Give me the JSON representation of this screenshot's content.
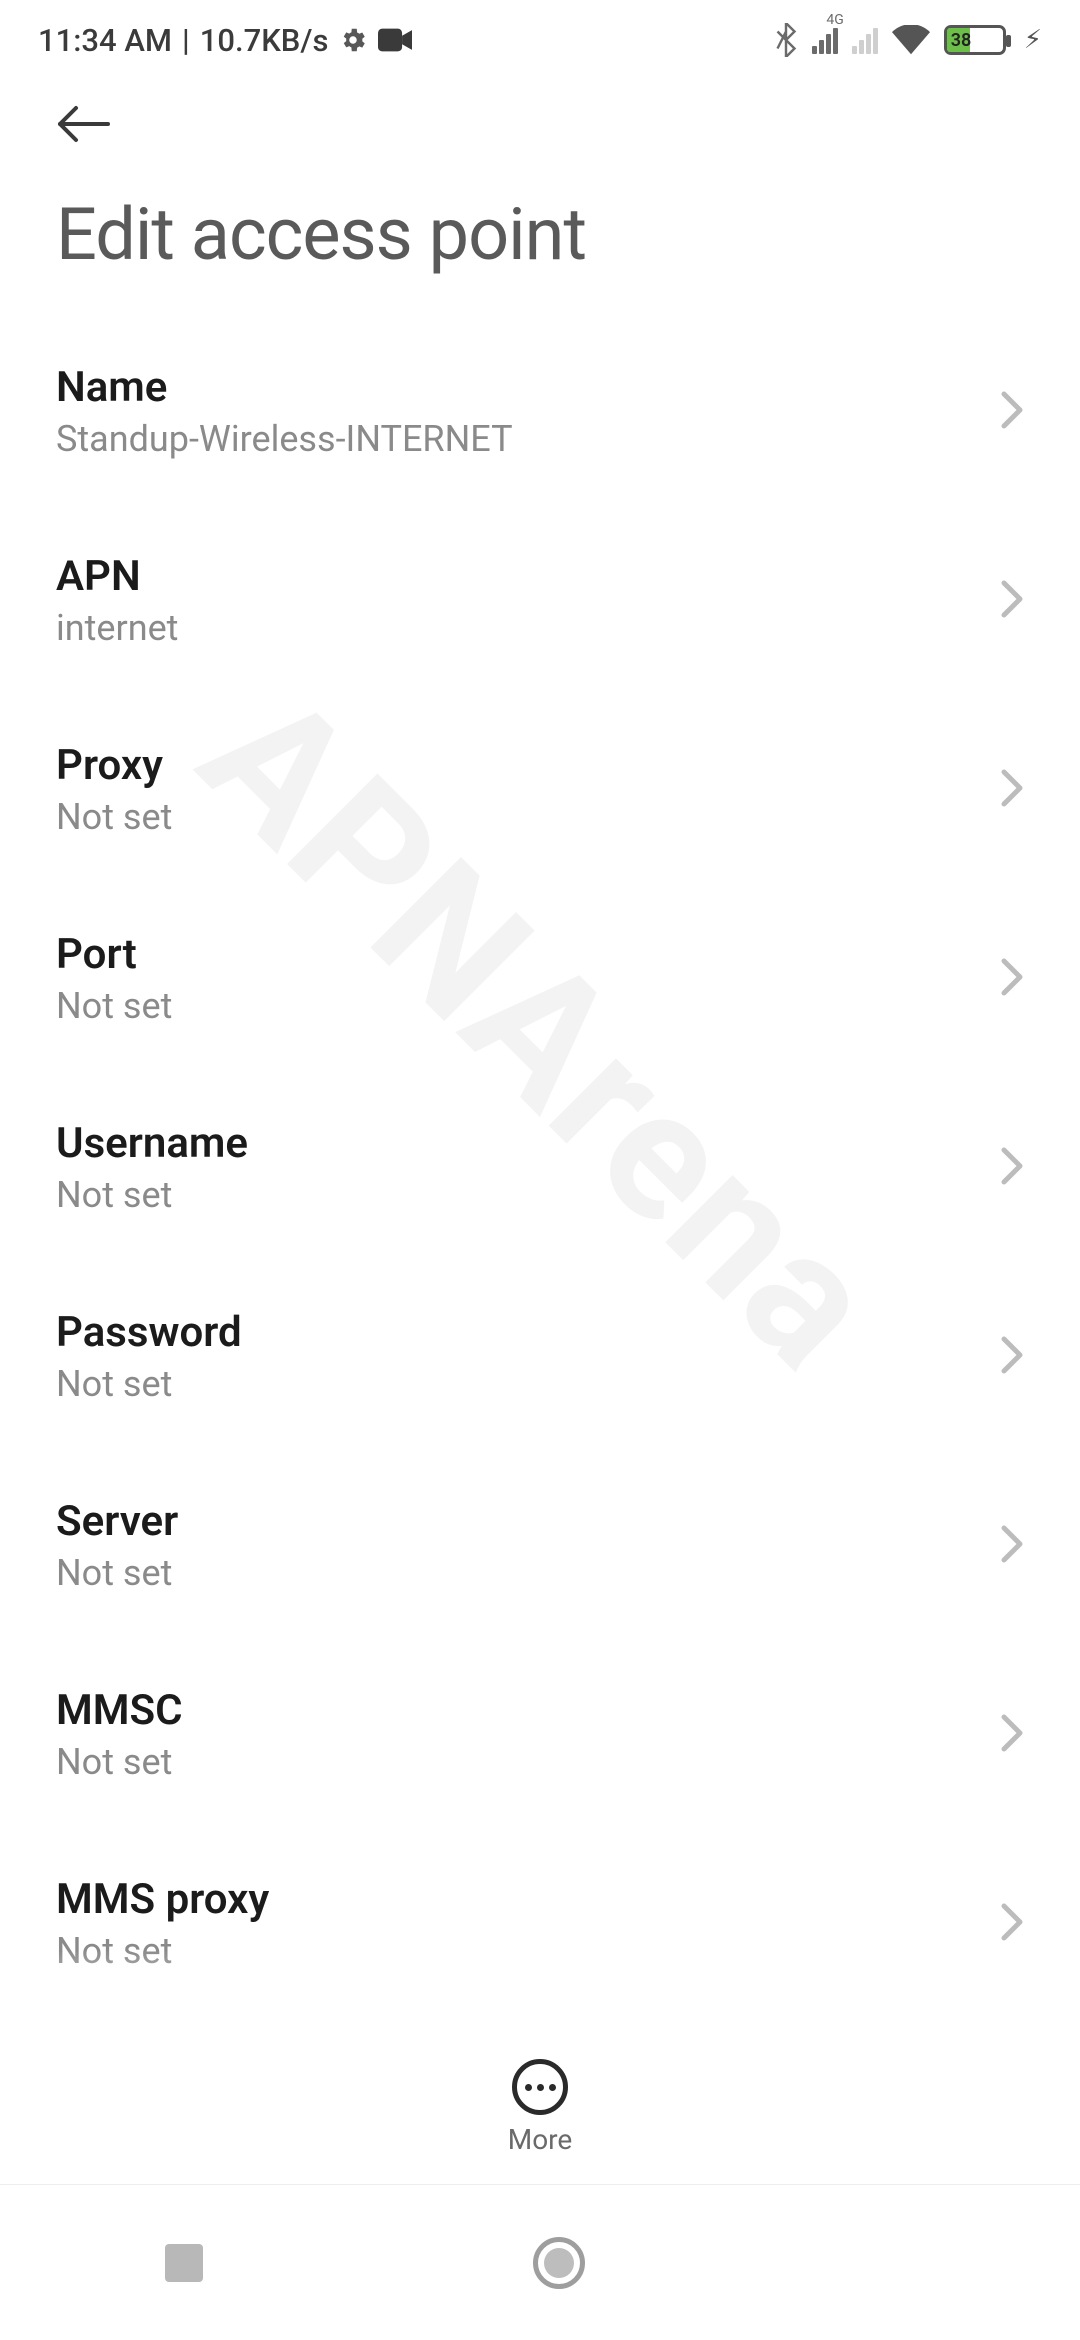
{
  "status": {
    "time": "11:34 AM",
    "separator": "|",
    "speed": "10.7KB/s",
    "battery_percent": "38",
    "signal1_label": "4G"
  },
  "header": {
    "title": "Edit access point"
  },
  "settings": [
    {
      "label": "Name",
      "value": "Standup-Wireless-INTERNET"
    },
    {
      "label": "APN",
      "value": "internet"
    },
    {
      "label": "Proxy",
      "value": "Not set"
    },
    {
      "label": "Port",
      "value": "Not set"
    },
    {
      "label": "Username",
      "value": "Not set"
    },
    {
      "label": "Password",
      "value": "Not set"
    },
    {
      "label": "Server",
      "value": "Not set"
    },
    {
      "label": "MMSC",
      "value": "Not set"
    },
    {
      "label": "MMS proxy",
      "value": "Not set"
    }
  ],
  "action_bar": {
    "more_label": "More"
  },
  "watermark_text": "APNArena"
}
